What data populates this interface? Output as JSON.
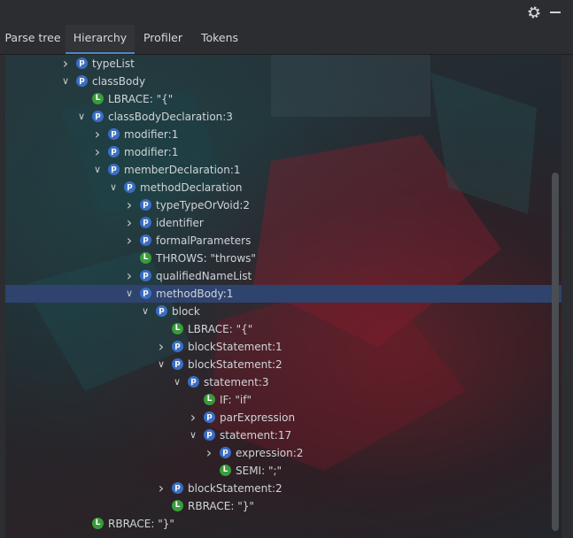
{
  "tabs": [
    {
      "label": "Parse tree"
    },
    {
      "label": "Hierarchy"
    },
    {
      "label": "Profiler"
    },
    {
      "label": "Tokens"
    }
  ],
  "active_tab": "Hierarchy",
  "tree": [
    {
      "depth": 3,
      "expander": "collapsed",
      "kind": "p",
      "label": "typeList"
    },
    {
      "depth": 3,
      "expander": "expanded",
      "kind": "p",
      "label": "classBody"
    },
    {
      "depth": 4,
      "expander": "none",
      "kind": "l",
      "label": "LBRACE: \"{\""
    },
    {
      "depth": 4,
      "expander": "expanded",
      "kind": "p",
      "label": "classBodyDeclaration:3"
    },
    {
      "depth": 5,
      "expander": "collapsed",
      "kind": "p",
      "label": "modifier:1"
    },
    {
      "depth": 5,
      "expander": "collapsed",
      "kind": "p",
      "label": "modifier:1"
    },
    {
      "depth": 5,
      "expander": "expanded",
      "kind": "p",
      "label": "memberDeclaration:1"
    },
    {
      "depth": 6,
      "expander": "expanded",
      "kind": "p",
      "label": "methodDeclaration"
    },
    {
      "depth": 7,
      "expander": "collapsed",
      "kind": "p",
      "label": "typeTypeOrVoid:2"
    },
    {
      "depth": 7,
      "expander": "collapsed",
      "kind": "p",
      "label": "identifier"
    },
    {
      "depth": 7,
      "expander": "collapsed",
      "kind": "p",
      "label": "formalParameters"
    },
    {
      "depth": 7,
      "expander": "none",
      "kind": "l",
      "label": "THROWS: \"throws\""
    },
    {
      "depth": 7,
      "expander": "collapsed",
      "kind": "p",
      "label": "qualifiedNameList"
    },
    {
      "depth": 7,
      "expander": "expanded",
      "kind": "p",
      "label": "methodBody:1",
      "selected": true
    },
    {
      "depth": 8,
      "expander": "expanded",
      "kind": "p",
      "label": "block"
    },
    {
      "depth": 9,
      "expander": "none",
      "kind": "l",
      "label": "LBRACE: \"{\""
    },
    {
      "depth": 9,
      "expander": "collapsed",
      "kind": "p",
      "label": "blockStatement:1"
    },
    {
      "depth": 9,
      "expander": "expanded",
      "kind": "p",
      "label": "blockStatement:2"
    },
    {
      "depth": 10,
      "expander": "expanded",
      "kind": "p",
      "label": "statement:3"
    },
    {
      "depth": 11,
      "expander": "none",
      "kind": "l",
      "label": "IF: \"if\""
    },
    {
      "depth": 11,
      "expander": "collapsed",
      "kind": "p",
      "label": "parExpression"
    },
    {
      "depth": 11,
      "expander": "expanded",
      "kind": "p",
      "label": "statement:17"
    },
    {
      "depth": 12,
      "expander": "collapsed",
      "kind": "p",
      "label": "expression:2"
    },
    {
      "depth": 12,
      "expander": "none",
      "kind": "l",
      "label": "SEMI: \";\""
    },
    {
      "depth": 9,
      "expander": "collapsed",
      "kind": "p",
      "label": "blockStatement:2"
    },
    {
      "depth": 9,
      "expander": "none",
      "kind": "l",
      "label": "RBRACE: \"}\""
    },
    {
      "depth": 4,
      "expander": "none",
      "kind": "l",
      "label": "RBRACE: \"}\""
    }
  ],
  "badge_letters": {
    "p": "p",
    "l": "L"
  },
  "icons": {
    "settings": "gear-icon",
    "hide": "minimize-icon"
  },
  "colors": {
    "accent": "#4a88c7",
    "selection": "#2e436e",
    "rule_badge": "#3b6ec2",
    "token_badge": "#3a9b3a"
  }
}
